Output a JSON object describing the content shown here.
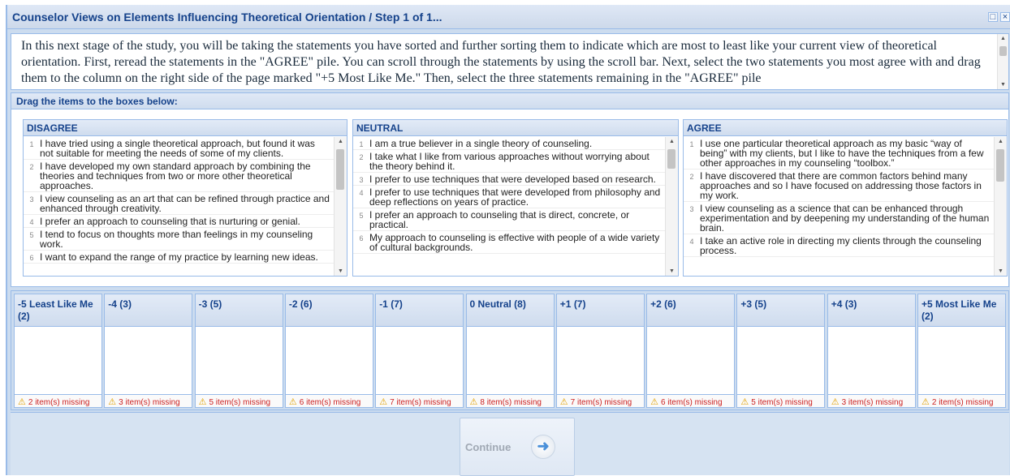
{
  "window": {
    "title": "Counselor Views on Elements Influencing Theoretical Orientation / Step 1 of 1...",
    "restore_glyph": "□",
    "close_glyph": "×"
  },
  "instructions": {
    "text": "In this next stage of the study, you will be taking the statements you have sorted and further sorting them to indicate which are most to least like your current view of theoretical orientation.  First, reread the statements in the \"AGREE\" pile. You can scroll through the statements by using the scroll bar. Next, select the two statements you most agree with and drag them to the column on the right side of the page marked \"+5 Most Like Me.\" Then, select the three statements remaining in the \"AGREE\" pile"
  },
  "drag_panel": {
    "header": "Drag the items to the boxes below:"
  },
  "piles": [
    {
      "name": "DISAGREE",
      "items": [
        {
          "num": "1",
          "text": "I have tried using a single theoretical approach, but found it was not suitable for meeting the needs of some of my clients."
        },
        {
          "num": "2",
          "text": "I have developed my own standard approach by combining the theories and techniques from two or more other theoretical approaches."
        },
        {
          "num": "3",
          "text": "I view counseling as an art that can be refined through practice and enhanced through creativity."
        },
        {
          "num": "4",
          "text": "I prefer an approach to counseling that is nurturing or genial."
        },
        {
          "num": "5",
          "text": "I tend to focus on thoughts more than feelings in my counseling work."
        },
        {
          "num": "6",
          "text": "I want to expand the range of my practice by learning new ideas."
        }
      ]
    },
    {
      "name": "NEUTRAL",
      "items": [
        {
          "num": "1",
          "text": "I am a true believer in a single theory of counseling."
        },
        {
          "num": "2",
          "text": "I take what I like from various approaches without worrying about the theory behind it."
        },
        {
          "num": "3",
          "text": "I prefer to use techniques that were developed based on research."
        },
        {
          "num": "4",
          "text": "I prefer to use techniques that were developed from philosophy and deep reflections on years of practice."
        },
        {
          "num": "5",
          "text": "I prefer an approach to counseling that is direct, concrete, or practical."
        },
        {
          "num": "6",
          "text": "My approach to counseling is effective with people of a wide variety of cultural backgrounds."
        }
      ]
    },
    {
      "name": "AGREE",
      "items": [
        {
          "num": "1",
          "text": "I use one particular theoretical approach as my basic “way of being” with my clients, but I like to have the techniques from a few other approaches in my counseling “toolbox.”"
        },
        {
          "num": "2",
          "text": "I have discovered that there are common factors behind many approaches and so I have focused on addressing those factors in my work."
        },
        {
          "num": "3",
          "text": "I view counseling as a science that can be enhanced through experimentation and by deepening my understanding of the human brain."
        },
        {
          "num": "4",
          "text": "I take an active role in directing my clients through the counseling process."
        }
      ]
    }
  ],
  "buckets": [
    {
      "label": "-5 Least Like Me (2)",
      "missing": "2 item(s) missing"
    },
    {
      "label": "-4 (3)",
      "missing": "3 item(s) missing"
    },
    {
      "label": "-3 (5)",
      "missing": "5 item(s) missing"
    },
    {
      "label": "-2 (6)",
      "missing": "6 item(s) missing"
    },
    {
      "label": "-1 (7)",
      "missing": "7 item(s) missing"
    },
    {
      "label": "0 Neutral (8)",
      "missing": "8 item(s) missing"
    },
    {
      "label": "+1 (7)",
      "missing": "7 item(s) missing"
    },
    {
      "label": "+2 (6)",
      "missing": "6 item(s) missing"
    },
    {
      "label": "+3 (5)",
      "missing": "5 item(s) missing"
    },
    {
      "label": "+4 (3)",
      "missing": "3 item(s) missing"
    },
    {
      "label": "+5 Most Like Me (2)",
      "missing": "2 item(s) missing"
    }
  ],
  "footer": {
    "continue_label": "Continue",
    "continue_icon": "arrow-right-icon"
  }
}
